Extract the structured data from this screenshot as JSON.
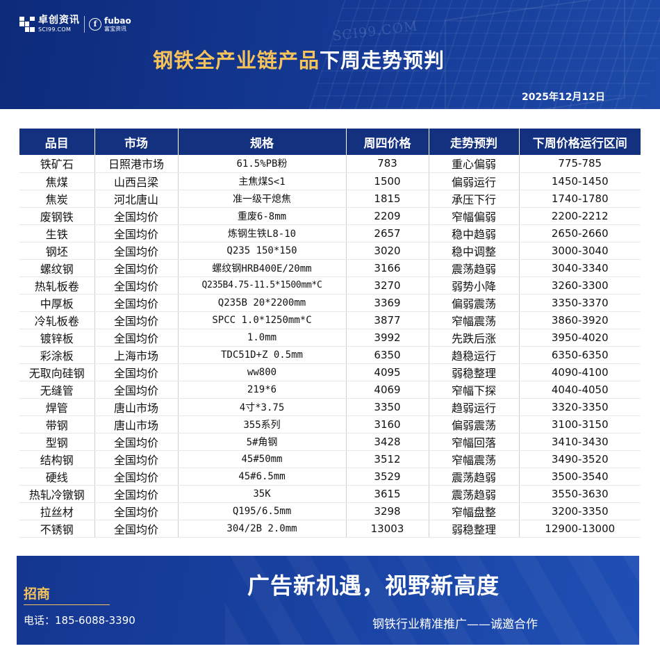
{
  "header": {
    "logo_cn": "卓创资讯",
    "logo_en": "SCI99.COM",
    "logo2_en": "fubao",
    "logo2_cn": "富宝资讯",
    "logo2_mark": "f",
    "watermark": "SCI99.COM",
    "title_highlight": "钢铁全产业链产品",
    "title_rest": "下周走势预判",
    "date": "2025年12月12日"
  },
  "table": {
    "headers": [
      "品目",
      "市场",
      "规格",
      "周四价格",
      "走势预判",
      "下周价格运行区间"
    ],
    "rows": [
      [
        "铁矿石",
        "日照港市场",
        "61.5%PB粉",
        "783",
        "重心偏弱",
        "775-785"
      ],
      [
        "焦煤",
        "山西吕梁",
        "主焦煤S<1",
        "1500",
        "偏弱运行",
        "1450-1450"
      ],
      [
        "焦炭",
        "河北唐山",
        "准一级干熄焦",
        "1815",
        "承压下行",
        "1740-1780"
      ],
      [
        "废钢铁",
        "全国均价",
        "重废6-8mm",
        "2209",
        "窄幅偏弱",
        "2200-2212"
      ],
      [
        "生铁",
        "全国均价",
        "炼钢生铁L8-10",
        "2657",
        "稳中趋弱",
        "2650-2660"
      ],
      [
        "钢坯",
        "全国均价",
        "Q235  150*150",
        "3020",
        "稳中调整",
        "3000-3040"
      ],
      [
        "螺纹钢",
        "全国均价",
        "螺纹钢HRB400E/20mm",
        "3166",
        "震荡趋弱",
        "3040-3340"
      ],
      [
        "热轧板卷",
        "全国均价",
        "Q235B4.75-11.5*1500mm*C",
        "3270",
        "弱势小降",
        "3260-3300"
      ],
      [
        "中厚板",
        "全国均价",
        "Q235B 20*2200mm",
        "3369",
        "偏弱震荡",
        "3350-3370"
      ],
      [
        "冷轧板卷",
        "全国均价",
        "SPCC 1.0*1250mm*C",
        "3877",
        "窄幅震荡",
        "3860-3920"
      ],
      [
        "镀锌板",
        "全国均价",
        "1.0mm",
        "3992",
        "先跌后涨",
        "3950-4020"
      ],
      [
        "彩涂板",
        "上海市场",
        "TDC51D+Z 0.5mm",
        "6350",
        "趋稳运行",
        "6350-6350"
      ],
      [
        "无取向硅钢",
        "全国均价",
        "ww800",
        "4095",
        "弱稳整理",
        "4090-4100"
      ],
      [
        "无缝管",
        "全国均价",
        "219*6",
        "4069",
        "窄幅下探",
        "4040-4050"
      ],
      [
        "焊管",
        "唐山市场",
        "4寸*3.75",
        "3350",
        "趋弱运行",
        "3320-3350"
      ],
      [
        "带钢",
        "唐山市场",
        "355系列",
        "3160",
        "偏弱震荡",
        "3100-3150"
      ],
      [
        "型钢",
        "全国均价",
        "5#角钢",
        "3428",
        "窄幅回落",
        "3410-3430"
      ],
      [
        "结构钢",
        "全国均价",
        "45#50mm",
        "3512",
        "窄幅震荡",
        "3490-3520"
      ],
      [
        "硬线",
        "全国均价",
        "45#6.5mm",
        "3529",
        "震荡趋弱",
        "3500-3540"
      ],
      [
        "热轧冷镦钢",
        "全国均价",
        "35K",
        "3615",
        "震荡趋弱",
        "3550-3630"
      ],
      [
        "拉丝材",
        "全国均价",
        "Q195/6.5mm",
        "3298",
        "窄幅盘整",
        "3200-3350"
      ],
      [
        "不锈钢",
        "全国均价",
        "304/2B 2.0mm",
        "13003",
        "弱稳整理",
        "12900-13000"
      ]
    ]
  },
  "footer": {
    "recruit": "招商",
    "phone": "电话：185-6088-3390",
    "slogan": "广告新机遇，视野新高度",
    "subslogan": "钢铁行业精准推广——诚邀合作"
  },
  "colors": {
    "header_bg": "#153a96",
    "table_header_bg": "#14317f",
    "title_highlight": "#f6c35a",
    "footer_bg": "#1a45a6"
  }
}
